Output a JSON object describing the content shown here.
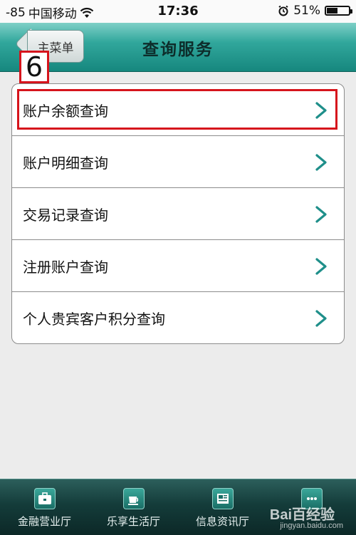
{
  "status_bar": {
    "signal": "-85",
    "carrier": "中国移动",
    "time": "17:36",
    "battery": "51%",
    "battery_level": 0.51
  },
  "nav": {
    "back_label": "主菜单",
    "title": "查询服务"
  },
  "annotation": {
    "step": "6"
  },
  "menu": {
    "items": [
      {
        "label": "账户余额查询"
      },
      {
        "label": "账户明细查询"
      },
      {
        "label": "交易记录查询"
      },
      {
        "label": "注册账户查询"
      },
      {
        "label": "个人贵宾客户积分查询"
      }
    ]
  },
  "tabs": [
    {
      "label": "金融营业厅",
      "icon": "briefcase-icon"
    },
    {
      "label": "乐享生活厅",
      "icon": "coffee-cup-icon"
    },
    {
      "label": "信息资讯厅",
      "icon": "newspaper-icon"
    },
    {
      "label": "",
      "icon": "more-icon"
    }
  ],
  "watermark": {
    "brand": "Bai百经验",
    "url": "jingyan.baidu.com"
  },
  "colors": {
    "accent": "#31a79c",
    "highlight": "#d6141c",
    "chevron": "#1f8f8a"
  }
}
